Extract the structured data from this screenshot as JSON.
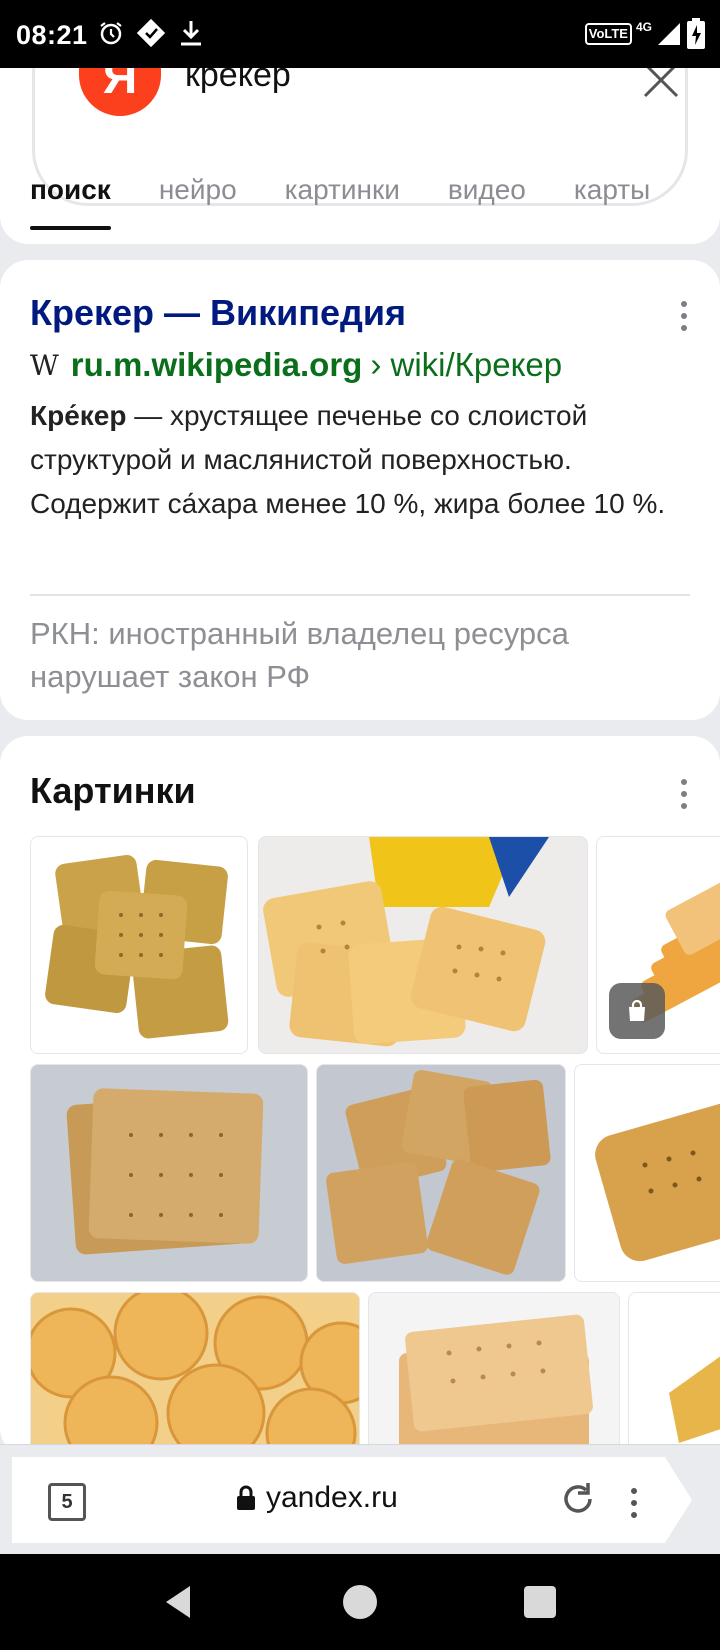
{
  "status": {
    "time": "08:21",
    "network": "VoLTE",
    "signal": "4G"
  },
  "search": {
    "logo": "Я",
    "query": "крекер"
  },
  "tabs": [
    {
      "label": "поиск",
      "active": true
    },
    {
      "label": "нейро",
      "active": false
    },
    {
      "label": "картинки",
      "active": false
    },
    {
      "label": "видео",
      "active": false
    },
    {
      "label": "карты",
      "active": false
    }
  ],
  "result": {
    "title": "Крекер — Википедия",
    "site_mark": "W",
    "url_host": "ru.m.wikipedia.org",
    "url_path": "› wiki/Крекер",
    "snippet_term": "Кре́кер",
    "snippet_rest": " — хрустящее печенье со слоистой структурой и маслянистой поверхностью. Содержит са́хара менее 10 %, жира более 10 %.",
    "notice": "РКН: иностранный владелец ресурса нарушает закон РФ"
  },
  "images": {
    "title": "Картинки"
  },
  "browser": {
    "tab_count": "5",
    "address": "yandex.ru"
  },
  "colors": {
    "accent_red": "#fc3f1d",
    "link_title": "#001a80",
    "url_green": "#0b6e1a"
  }
}
